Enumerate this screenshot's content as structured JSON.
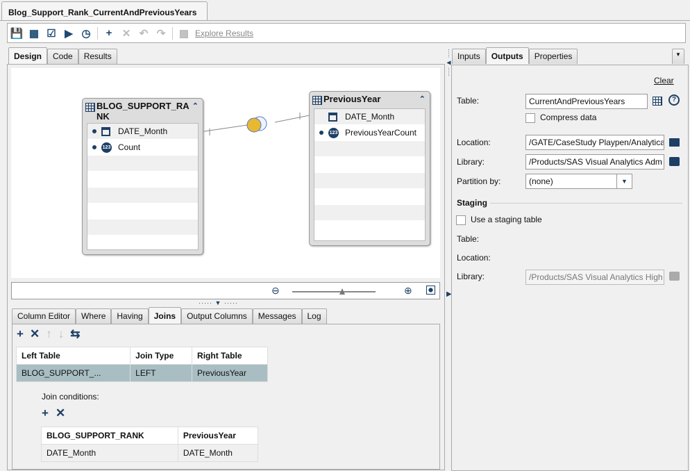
{
  "document_tab": "Blog_Support_Rank_CurrentAndPreviousYears",
  "toolbar": {
    "explore_results": "Explore Results"
  },
  "design_tabs": [
    "Design",
    "Code",
    "Results"
  ],
  "nodes": {
    "left": {
      "title": "BLOG_SUPPORT_RA NK",
      "columns": [
        {
          "name": "DATE_Month",
          "type": "date"
        },
        {
          "name": "Count",
          "type": "numeric",
          "badge": "123"
        }
      ]
    },
    "right": {
      "title": "PreviousYear",
      "columns": [
        {
          "name": "DATE_Month",
          "type": "date"
        },
        {
          "name": "PreviousYearCount",
          "type": "numeric",
          "badge": "123"
        }
      ]
    }
  },
  "zoom": {
    "level_percent": 60
  },
  "bottom_tabs": [
    "Column Editor",
    "Where",
    "Having",
    "Joins",
    "Output Columns",
    "Messages",
    "Log"
  ],
  "joins": {
    "headers": [
      "Left Table",
      "Join Type",
      "Right Table"
    ],
    "rows": [
      [
        "BLOG_SUPPORT_...",
        "LEFT",
        "PreviousYear"
      ]
    ],
    "conditions_label": "Join conditions:",
    "cond_headers": [
      "BLOG_SUPPORT_RANK",
      "PreviousYear"
    ],
    "cond_rows": [
      [
        "DATE_Month",
        "DATE_Month"
      ]
    ]
  },
  "right_tabs": [
    "Inputs",
    "Outputs",
    "Properties"
  ],
  "outputs": {
    "clear": "Clear",
    "table_label": "Table:",
    "table_value": "CurrentAndPreviousYears",
    "compress": "Compress data",
    "location_label": "Location:",
    "location_value": "/GATE/CaseStudy Playpen/Analytica",
    "library_label": "Library:",
    "library_value": "/Products/SAS Visual Analytics Adm",
    "partition_label": "Partition by:",
    "partition_value": "(none)",
    "staging_heading": "Staging",
    "use_staging": "Use a staging table",
    "staging_table_label": "Table:",
    "staging_location_label": "Location:",
    "staging_library_label": "Library:",
    "staging_library_value": "/Products/SAS Visual Analytics High"
  }
}
